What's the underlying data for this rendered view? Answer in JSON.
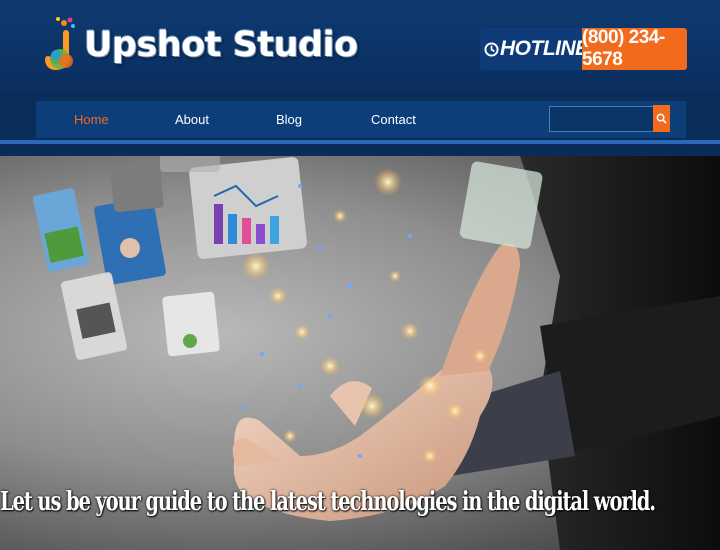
{
  "header": {
    "logo_text": "Upshot Studio",
    "hotline_label": "HOTLINE",
    "hotline_number": "(800) 234-5678"
  },
  "nav": {
    "items": [
      {
        "label": "Home",
        "active": true
      },
      {
        "label": "About",
        "active": false
      },
      {
        "label": "Blog",
        "active": false
      },
      {
        "label": "Contact",
        "active": false
      }
    ],
    "search_value": ""
  },
  "hero": {
    "caption": "Let us be your guide to the latest technologies in the digital world."
  },
  "colors": {
    "brand_blue": "#0b3c78",
    "accent_orange": "#f26a1b"
  },
  "icons": [
    "logo-mark-icon",
    "clock-icon",
    "search-icon"
  ]
}
